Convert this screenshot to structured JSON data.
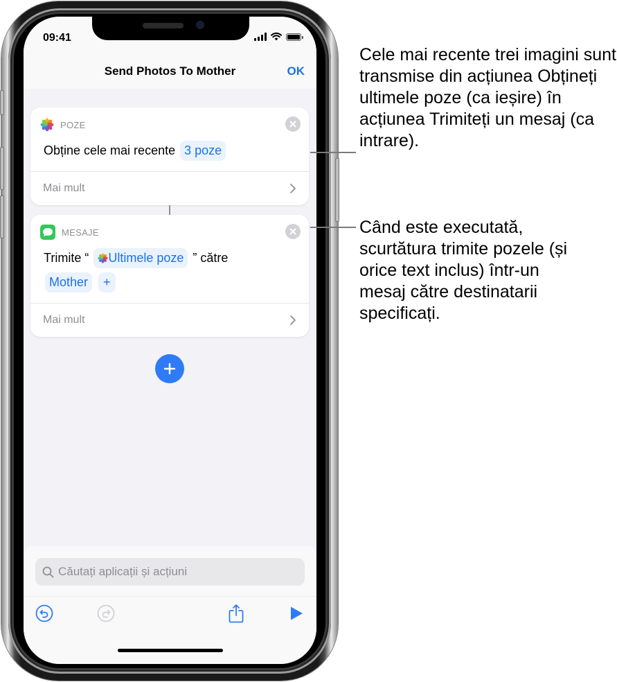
{
  "status_bar": {
    "time": "09:41"
  },
  "nav": {
    "title": "Send Photos To Mother",
    "done_label": "OK"
  },
  "actions": [
    {
      "app_icon": "photos-icon",
      "app_label": "POZE",
      "text_before": "Obține cele mai recente",
      "token": "3 poze",
      "more_label": "Mai mult"
    },
    {
      "app_icon": "messages-icon",
      "app_label": "MESAJE",
      "text_before": "Trimite “",
      "token": "Ultimele poze",
      "text_after": "” către",
      "recipient": "Mother",
      "add_recipient": "+",
      "more_label": "Mai mult"
    }
  ],
  "bottom": {
    "search_placeholder": "Căutați aplicații și acțiuni",
    "toolbar": [
      "undo-icon",
      "redo-icon",
      "share-icon",
      "play-icon"
    ]
  },
  "callouts": [
    "Cele mai recente trei imagini sunt transmise din acțiunea Obțineți ultimele poze (ca ieșire) în acțiunea Trimiteți un mesaj (ca intrare).",
    "Când este executată, scurtătura trimite pozele (și orice text inclus) într-un mesaj către destinatarii specificați."
  ],
  "colors": {
    "accent": "#1a73e8",
    "token_bg": "#eaf2fe",
    "background": "#f2f2f7"
  }
}
